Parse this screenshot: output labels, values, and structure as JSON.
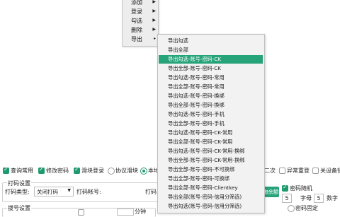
{
  "context_menu": {
    "items": [
      {
        "label": "添加"
      },
      {
        "label": "登录"
      },
      {
        "label": "勾选"
      },
      {
        "label": "删除"
      },
      {
        "label": "导出"
      }
    ]
  },
  "export_submenu": {
    "items": [
      {
        "label": "导出勾选"
      },
      {
        "label": "导出全部"
      },
      {
        "label": "导出勾选-账号-密码-CK"
      },
      {
        "label": "导出全部-账号-密码-CK"
      },
      {
        "label": "导出勾选-账号-密码-常用"
      },
      {
        "label": "导出全部-账号-密码-常用"
      },
      {
        "label": "导出勾选-账号-密码-换绑"
      },
      {
        "label": "导出全部-账号-密码-换绑"
      },
      {
        "label": "导出勾选-账号-密码-手机"
      },
      {
        "label": "导出全部-账号-密码-手机"
      },
      {
        "label": "导出勾选-账号-密码-CK-常用"
      },
      {
        "label": "导出全部-账号-密码-CK-常用"
      },
      {
        "label": "导出勾选-账号-密码-CK-常用-换绑"
      },
      {
        "label": "导出全部-账号-密码-CK-常用-换绑"
      },
      {
        "label": "导出全部-账号-密码-不可换绑"
      },
      {
        "label": "导出全部-账号-密码-可换绑"
      },
      {
        "label": "导出全部-账号-密码-Clientkey"
      },
      {
        "label": "导出全部(账号-密码-信用分筛选)"
      },
      {
        "label": "导出勾选(账号-密码-信用分筛选)"
      }
    ],
    "highlighted_index": 2
  },
  "options": {
    "query_common": "查询常用",
    "modify_password": "修改密码",
    "slider_login": "滑块登录",
    "protocol_slider": "协议滑块",
    "local_partial": "本地",
    "second": "二次",
    "abnormal_recheck": "异常重登",
    "close_device_partial": "关设备锁"
  },
  "coding": {
    "group_title": "打码设置",
    "type_label": "打码类型:",
    "type_value": "关闭打码",
    "account_label": "打码帐号:",
    "partial_label": "打码"
  },
  "password": {
    "random_label": "密码随机",
    "letters_count": "5",
    "letters_label": "字母",
    "digits_count": "5",
    "digits_label": "数字",
    "fixed_partial": "密码固定"
  },
  "query_balance_button": "询余额",
  "dial": {
    "group_title": "拔号设置",
    "unit_label": "分钟"
  },
  "colors": {
    "accent": "#27a37a",
    "menu_bg": "#f2f2f2",
    "highlight_text": "#ffffff"
  }
}
